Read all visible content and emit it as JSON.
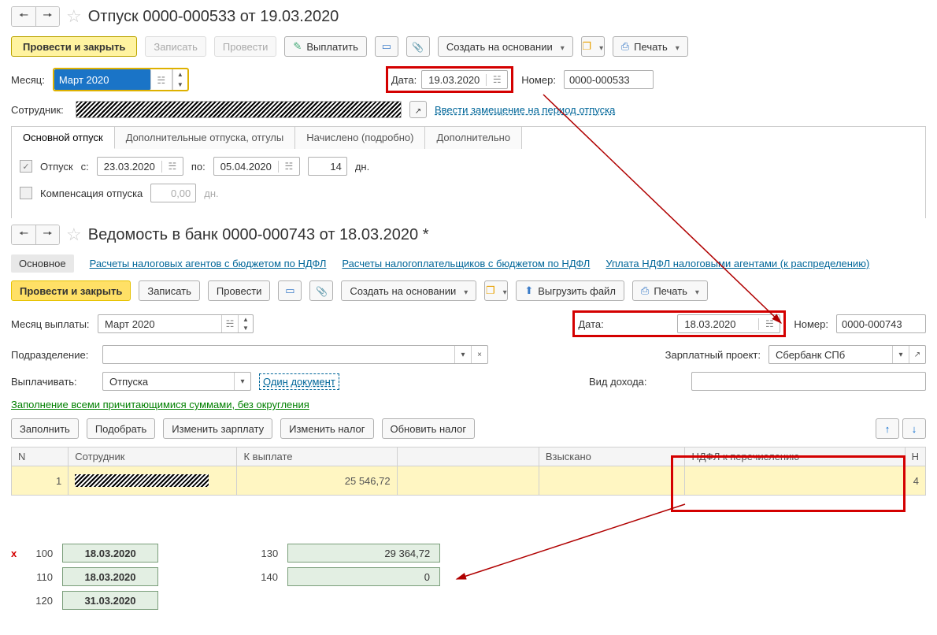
{
  "form1": {
    "title": "Отпуск 0000-000533 от 19.03.2020",
    "toolbar": {
      "run_close": "Провести и закрыть",
      "save": "Записать",
      "run": "Провести",
      "pay": "Выплатить",
      "create_on": "Создать на основании",
      "print": "Печать"
    },
    "month_label": "Месяц:",
    "month_value": "Март 2020",
    "date_label": "Дата:",
    "date_value": "19.03.2020",
    "number_label": "Номер:",
    "number_value": "0000-000533",
    "employee_label": "Сотрудник:",
    "subst_link": "Ввести замещение на период отпуска",
    "tabs": [
      "Основной отпуск",
      "Дополнительные отпуска, отгулы",
      "Начислено (подробно)",
      "Дополнительно"
    ],
    "tab1": {
      "vac_label": "Отпуск",
      "from_label": "с:",
      "from_value": "23.03.2020",
      "to_label": "по:",
      "to_value": "05.04.2020",
      "days_value": "14",
      "days_unit": "дн.",
      "comp_label": "Компенсация отпуска",
      "comp_value": "0,00",
      "comp_unit": "дн."
    }
  },
  "form2": {
    "title": "Ведомость в банк 0000-000743 от 18.03.2020 *",
    "nav": {
      "main": "Основное",
      "link1": "Расчеты налоговых агентов с бюджетом по НДФЛ",
      "link2": "Расчеты налогоплательщиков с бюджетом по НДФЛ",
      "link3": "Уплата НДФЛ налоговыми агентами (к распределению)"
    },
    "toolbar": {
      "run_close": "Провести и закрыть",
      "save": "Записать",
      "run": "Провести",
      "create_on": "Создать на основании",
      "upload": "Выгрузить файл",
      "print": "Печать"
    },
    "paymonth_label": "Месяц выплаты:",
    "paymonth_value": "Март 2020",
    "date_label": "Дата:",
    "date_value": "18.03.2020",
    "number_label": "Номер:",
    "number_value": "0000-000743",
    "dept_label": "Подразделение:",
    "salary_proj_label": "Зарплатный проект:",
    "salary_proj_value": "Сбербанк СПб",
    "pay_label": "Выплачивать:",
    "pay_value": "Отпуска",
    "one_doc_link": "Один документ",
    "income_label": "Вид дохода:",
    "fill_link": "Заполнение всеми причитающимися суммами, без округления",
    "tbl_toolbar": {
      "fill": "Заполнить",
      "pick": "Подобрать",
      "change_salary": "Изменить зарплату",
      "change_tax": "Изменить налог",
      "update_tax": "Обновить налог"
    },
    "table": {
      "cols": [
        "N",
        "Сотрудник",
        "К выплате",
        "",
        "Взыскано",
        "НДФЛ к перечислению",
        "Н"
      ],
      "row": {
        "n": "1",
        "amount": "25 546,72",
        "extra": "4"
      }
    }
  },
  "tax": {
    "r100": {
      "code": "100",
      "val": "18.03.2020"
    },
    "r110": {
      "code": "110",
      "val": "18.03.2020"
    },
    "r120": {
      "code": "120",
      "val": "31.03.2020"
    },
    "r130": {
      "code": "130",
      "val": "29 364,72"
    },
    "r140": {
      "code": "140",
      "val": "0"
    }
  }
}
